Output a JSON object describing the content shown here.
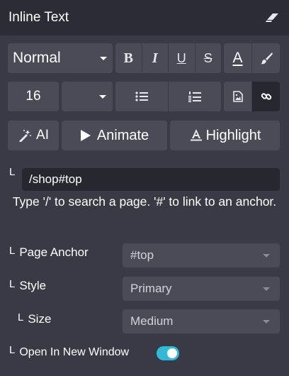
{
  "header": {
    "title": "Inline Text"
  },
  "toolbar": {
    "font_style": "Normal",
    "bold": "B",
    "italic": "I",
    "underline": "U",
    "strikethrough": "S",
    "text_color_glyph": "A",
    "font_size": "16",
    "ai_label": "AI",
    "animate_label": "Animate",
    "highlight_label": "Highlight"
  },
  "link": {
    "url_value": "/shop#top",
    "help_text": "Type '/' to search a page. '#' to link to an anchor."
  },
  "fields": {
    "page_anchor": {
      "label": "Page Anchor",
      "value": "#top"
    },
    "style": {
      "label": "Style",
      "value": "Primary"
    },
    "size": {
      "label": "Size",
      "value": "Medium"
    },
    "new_window": {
      "label": "Open In New Window",
      "enabled": true
    }
  },
  "colors": {
    "panel_bg": "#3a3a46",
    "header_bg": "#2c2c36",
    "button_bg": "#4a4b57",
    "input_bg": "#27272f",
    "toggle_on": "#2fbbd8"
  },
  "elbow_glyph": "L"
}
